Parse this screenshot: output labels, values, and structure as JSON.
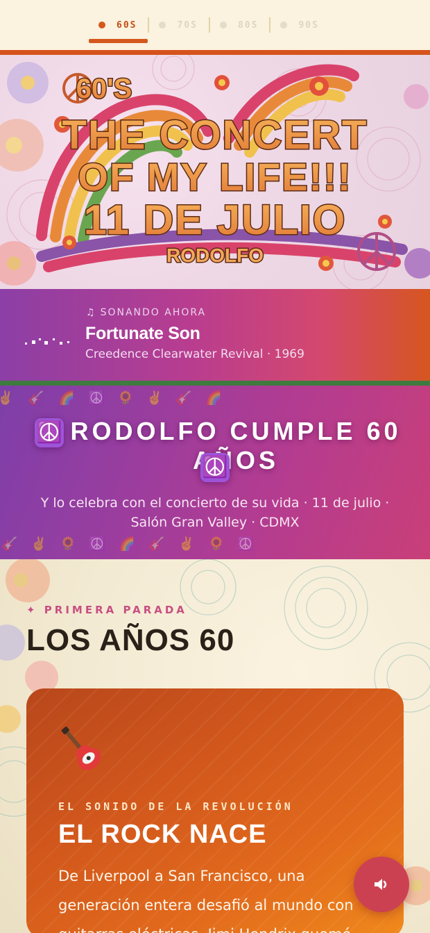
{
  "nav": {
    "tabs": [
      {
        "label": "60S",
        "active": true
      },
      {
        "label": "70S",
        "active": false
      },
      {
        "label": "80S",
        "active": false
      },
      {
        "label": "90S",
        "active": false
      }
    ]
  },
  "hero": {
    "line1": "60'S",
    "line2": "THE CONCERT",
    "line3": "OF MY LIFE!!!",
    "line4": "11 DE JULIO",
    "name": "RODOLFO"
  },
  "now_playing": {
    "label": "SONANDO AHORA",
    "label_icon": "music-note-icon",
    "song": "Fortunate Son",
    "artist_year": "Creedence Clearwater Revival · 1969"
  },
  "banner": {
    "title": "RODOLFO CUMPLE 60 AÑOS",
    "title_icon": "☮️",
    "subtitle_line1": "Y lo celebra con el concierto de su vida · 11 de julio ·",
    "subtitle_line2": "Salón Gran Valley · CDMX",
    "emoji": [
      "✌️",
      "🎸",
      "🌈",
      "☮️",
      "🌻"
    ]
  },
  "section": {
    "kicker": "✦ PRIMERA PARADA",
    "title": "LOS AÑOS 60"
  },
  "card": {
    "icon": "🎸",
    "kicker": "EL SONIDO DE LA REVOLUCIÓN",
    "title": "EL ROCK NACE",
    "text": "De Liverpool a San Francisco, una generación entera desafió al mundo con guitarras eléctricas. Jimi Hendrix quemó"
  },
  "colors": {
    "accent": "#d6531c",
    "purple": "#8c3fa6",
    "magenta": "#c84f82",
    "green": "#3f7a3e",
    "sound_button": "#cc4152"
  }
}
